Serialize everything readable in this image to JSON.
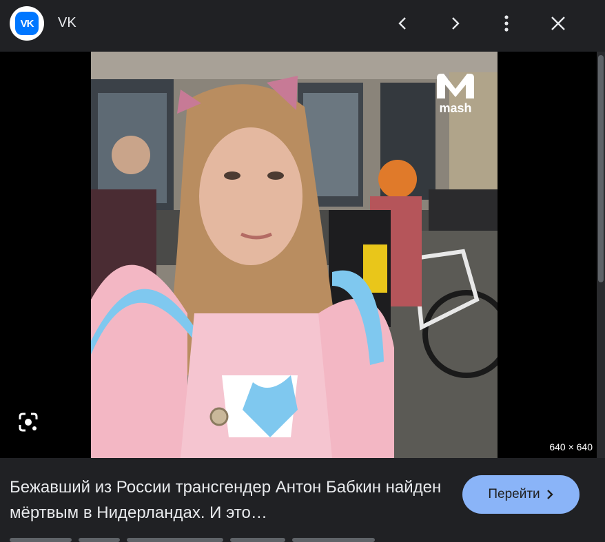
{
  "header": {
    "source_logo_text": "VK",
    "source_name": "VK",
    "icons": [
      "prev-chevron-icon",
      "next-chevron-icon",
      "more-vertical-icon",
      "close-icon"
    ]
  },
  "image": {
    "watermark": "mash",
    "dimensions": "640 × 640",
    "description_icon": "google-lens-icon"
  },
  "caption": {
    "text": "Бежавший из России трансгендер Антон Бабкин найден мёртвым в Нидерландах. И это…"
  },
  "visit_button": {
    "label": "Перейти",
    "icon": "chevron-right-icon"
  },
  "colors": {
    "background": "#202124",
    "accent": "#8ab4f8",
    "vk_blue": "#0077ff"
  }
}
